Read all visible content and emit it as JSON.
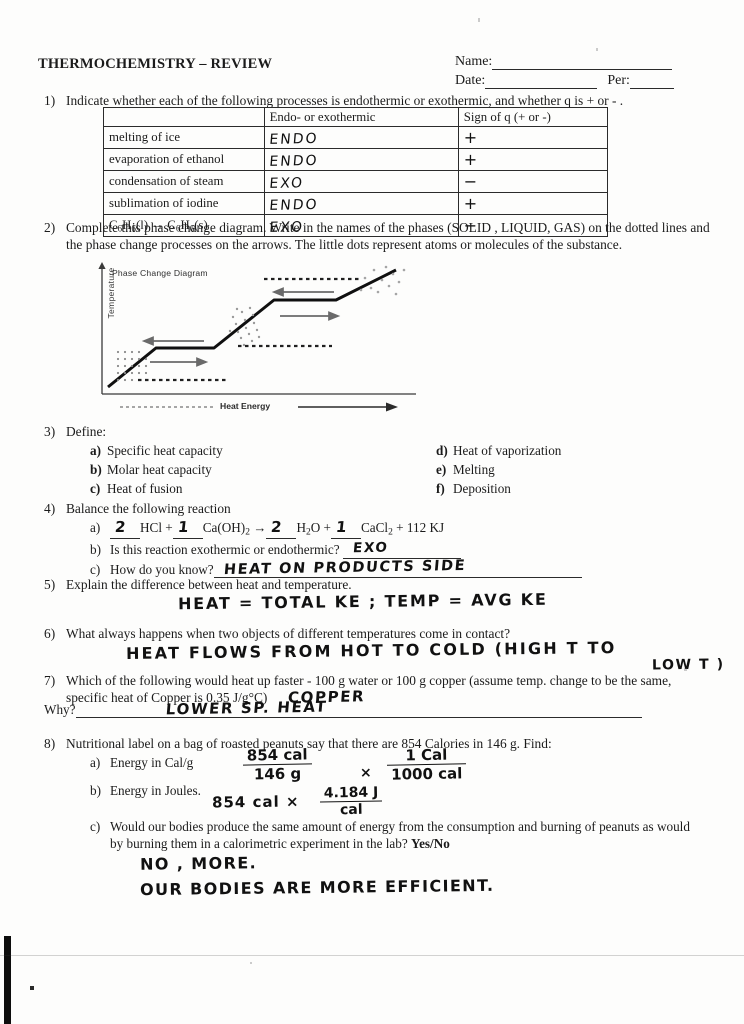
{
  "header": {
    "title": "THERMOCHEMISTRY – REVIEW",
    "name_label": "Name:",
    "name_value": "",
    "date_label": "Date:",
    "date_value": "",
    "per_label": "Per:",
    "per_value": ""
  },
  "q1": {
    "number": "1)",
    "prompt": "Indicate whether each of the following processes is endothermic or exothermic, and whether q is + or - .",
    "columns": [
      "",
      "Endo- or exothermic",
      "Sign of q (+ or -)"
    ],
    "rows": [
      {
        "process": "melting of ice",
        "answer": "ENDO",
        "sign": "+"
      },
      {
        "process": "evaporation of ethanol",
        "answer": "ENDO",
        "sign": "+"
      },
      {
        "process": "condensation of steam",
        "answer": "EXO",
        "sign": "−"
      },
      {
        "process": "sublimation of iodine",
        "answer": "ENDO",
        "sign": "+"
      },
      {
        "process": "C6H6(l) → C6H6(s)",
        "answer": "EXO",
        "sign": "−"
      }
    ]
  },
  "q2": {
    "number": "2)",
    "prompt_line1": "Complete this phase change diagram. Write in the names of the phases (SOLID , LIQUID, GAS) on the dotted",
    "prompt_line2": "lines and the phase change processes on the arrows. The little dots represent atoms or molecules of the substance.",
    "diagram": {
      "title": "Phase Change Diagram",
      "y_axis_label": "Temperature",
      "x_axis_label": "Heat Energy"
    }
  },
  "q3": {
    "number": "3)",
    "prompt": "Define:",
    "left_items": [
      {
        "letter": "a)",
        "text": "Specific heat capacity"
      },
      {
        "letter": "b)",
        "text": "Molar heat capacity"
      },
      {
        "letter": "c)",
        "text": "Heat of fusion"
      }
    ],
    "right_items": [
      {
        "letter": "d)",
        "text": "Heat of vaporization"
      },
      {
        "letter": "e)",
        "text": "Melting"
      },
      {
        "letter": "f)",
        "text": "Deposition"
      }
    ]
  },
  "q4": {
    "number": "4)",
    "prompt": "Balance the following reaction",
    "a_letter": "a)",
    "eq": {
      "coef1": "2",
      "reactant1": "HCl",
      "plus1": "+",
      "coef2": "1",
      "reactant2": "Ca(OH)2",
      "arrow": "→",
      "coef3": "2",
      "product1": "H2O",
      "plus2": "+",
      "coef4": "1",
      "product2": "CaCl2",
      "tail": "+ 112 KJ"
    },
    "b_letter": "b)",
    "b_prompt": "Is this reaction exothermic or endothermic?",
    "b_answer": "EXO",
    "c_letter": "c)",
    "c_prompt": "How do you know?",
    "c_answer": "HEAT  ON  PRODUCTS  SIDE"
  },
  "q5": {
    "number": "5)",
    "prompt": "Explain the difference between heat and temperature.",
    "answer": "HEAT = TOTAL KE ; TEMP = AVG KE"
  },
  "q6": {
    "number": "6)",
    "prompt": "What always happens when two objects of different temperatures come in contact?",
    "answer_line1": "HEAT FLOWS FROM HOT TO COLD (HIGH T TO",
    "answer_line2": "LOW T )"
  },
  "q7": {
    "number": "7)",
    "prompt_line1": "Which of the following would heat up faster - 100 g water or 100 g copper (assume temp. change to be the",
    "prompt_line2": "same, specific heat of Copper is 0.35 J/g°C)",
    "answer1": "COPPER",
    "why_label": "Why?",
    "answer2": "LOWER    SP. HEAT"
  },
  "q8": {
    "number": "8)",
    "prompt": "Nutritional label on a bag of roasted peanuts say that there are 854 Calories in 146 g. Find:",
    "a_letter": "a)",
    "a_prompt": "Energy in Cal/g",
    "a_work": {
      "frac1_num": "854 cal",
      "frac1_den": "146 g",
      "times": "×",
      "frac2_num": "1 Cal",
      "frac2_den": "1000 cal"
    },
    "b_letter": "b)",
    "b_prompt": "Energy in Joules.",
    "b_work": {
      "left": "854 cal  ×",
      "frac_num": "4.184 J",
      "frac_den": "cal"
    },
    "c_letter": "c)",
    "c_prompt_line1": "Would our bodies produce the same amount of energy from the consumption and burning of peanuts as",
    "c_prompt_line2": "would by burning them in a calorimetric experiment in the lab?",
    "c_yesno": "Yes/No",
    "c_answer_line1": "NO , MORE.",
    "c_answer_line2": "OUR  BODIES ARE MORE  EFFICIENT."
  }
}
